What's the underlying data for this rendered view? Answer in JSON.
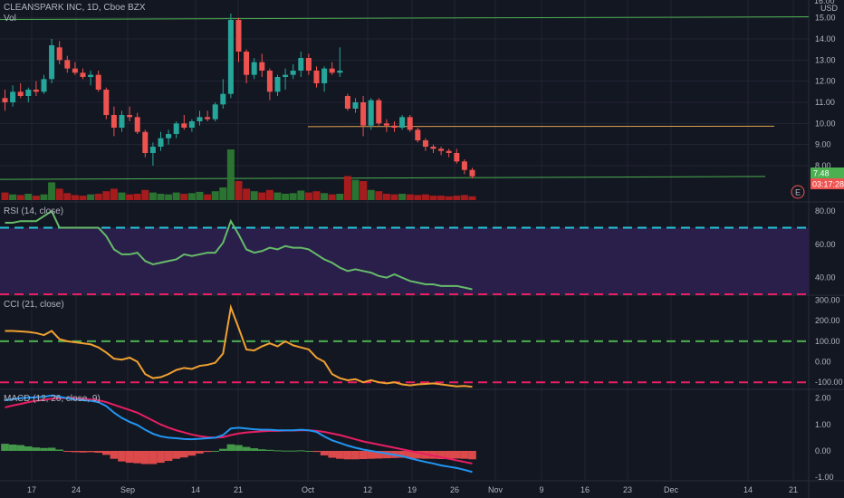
{
  "header": {
    "title": "CLEANSPARK INC, 1D, Cboe BZX",
    "vol_label": "Vol",
    "currency": "USD"
  },
  "colors": {
    "bg": "#131722",
    "grid": "#232632",
    "up": "#26a69a",
    "down": "#ef5350",
    "up_vol": "#2e7d32",
    "down_vol": "#b71c1c",
    "support": "#4caf50",
    "resistance": "#e0a050",
    "rsi_line": "#66bb6a",
    "rsi_fill": "#2a1f4a",
    "cyan_level": "#26c6da",
    "pink_level": "#e91e63",
    "cci_line": "#f0a030",
    "green_level": "#4caf50",
    "macd_line": "#2196f3",
    "signal_line": "#e91e63"
  },
  "price_panel": {
    "y_axis_labels": [
      "15.00",
      "14.00",
      "13.00",
      "12.00",
      "11.00",
      "10.00",
      "9.00",
      "8.00"
    ],
    "ylim": [
      6.5,
      15.5
    ],
    "last_price": "7.48",
    "countdown": "03:17:28",
    "earnings_badge": "E"
  },
  "rsi_panel": {
    "label": "RSI (14, close)",
    "y_axis_labels": [
      "80.00",
      "60.00",
      "40.00"
    ],
    "ylim": [
      30,
      85
    ],
    "upper": 70,
    "lower": 30
  },
  "cci_panel": {
    "label": "CCI (21, close)",
    "y_axis_labels": [
      "300.00",
      "200.00",
      "100.00",
      "0.00",
      "-100.00"
    ],
    "ylim": [
      -130,
      320
    ],
    "upper": 100,
    "lower": -100
  },
  "macd_panel": {
    "label": "MACD (12, 26, close, 9)",
    "y_axis_labels": [
      "2.00",
      "1.00",
      "0.00",
      "-1.00"
    ],
    "ylim": [
      -1.1,
      2.3
    ]
  },
  "x_axis_labels": [
    "17",
    "24",
    "Sep",
    "14",
    "21",
    "Oct",
    "12",
    "19",
    "26",
    "Nov",
    "9",
    "16",
    "23",
    "Dec",
    "14",
    "21"
  ],
  "chart_data": {
    "type": "candlestick",
    "title": "CLEANSPARK INC, 1D, Cboe BZX",
    "candles": [
      [
        11.2,
        11.6,
        10.6,
        11.0
      ],
      [
        11.0,
        11.8,
        10.8,
        11.5
      ],
      [
        11.5,
        11.9,
        11.2,
        11.3
      ],
      [
        11.3,
        11.7,
        11.0,
        11.6
      ],
      [
        11.6,
        12.0,
        11.3,
        11.5
      ],
      [
        11.5,
        12.3,
        11.4,
        12.1
      ],
      [
        12.1,
        14.0,
        11.9,
        13.7
      ],
      [
        13.6,
        13.9,
        12.8,
        13.0
      ],
      [
        13.0,
        13.2,
        12.4,
        12.6
      ],
      [
        12.6,
        12.9,
        12.3,
        12.4
      ],
      [
        12.4,
        12.6,
        12.1,
        12.2
      ],
      [
        12.2,
        12.5,
        11.8,
        12.3
      ],
      [
        12.3,
        12.5,
        11.5,
        11.6
      ],
      [
        11.6,
        11.7,
        10.2,
        10.4
      ],
      [
        10.4,
        10.8,
        9.4,
        9.8
      ],
      [
        9.8,
        10.6,
        9.6,
        10.4
      ],
      [
        10.4,
        10.8,
        10.1,
        10.3
      ],
      [
        10.3,
        10.5,
        9.5,
        9.6
      ],
      [
        9.6,
        9.7,
        8.4,
        8.6
      ],
      [
        8.6,
        9.1,
        8.0,
        8.9
      ],
      [
        8.9,
        9.6,
        8.7,
        9.3
      ],
      [
        9.3,
        9.7,
        9.0,
        9.5
      ],
      [
        9.5,
        10.1,
        9.3,
        10.0
      ],
      [
        10.0,
        10.4,
        9.7,
        9.8
      ],
      [
        9.8,
        10.2,
        9.6,
        10.1
      ],
      [
        10.1,
        10.6,
        9.9,
        10.3
      ],
      [
        10.3,
        10.6,
        10.1,
        10.2
      ],
      [
        10.2,
        11.0,
        10.1,
        10.9
      ],
      [
        10.9,
        12.1,
        10.7,
        11.4
      ],
      [
        11.4,
        15.2,
        11.2,
        14.9
      ],
      [
        14.9,
        15.0,
        12.9,
        13.4
      ],
      [
        13.4,
        13.5,
        11.9,
        12.3
      ],
      [
        12.3,
        13.1,
        12.1,
        12.9
      ],
      [
        12.9,
        13.3,
        12.2,
        12.5
      ],
      [
        12.5,
        12.6,
        11.1,
        11.5
      ],
      [
        11.5,
        12.3,
        11.3,
        12.2
      ],
      [
        12.2,
        12.6,
        11.6,
        12.3
      ],
      [
        12.3,
        12.8,
        12.1,
        12.5
      ],
      [
        12.5,
        13.4,
        12.2,
        13.1
      ],
      [
        13.1,
        13.3,
        12.3,
        12.5
      ],
      [
        12.5,
        12.7,
        11.7,
        11.9
      ],
      [
        11.9,
        12.7,
        11.5,
        12.6
      ],
      [
        12.6,
        12.9,
        12.3,
        12.4
      ],
      [
        12.4,
        13.6,
        12.2,
        12.5
      ],
      [
        11.3,
        11.4,
        10.6,
        10.7
      ],
      [
        10.7,
        11.2,
        10.5,
        11.0
      ],
      [
        11.0,
        11.3,
        9.4,
        9.9
      ],
      [
        9.9,
        11.2,
        9.7,
        11.1
      ],
      [
        11.1,
        11.2,
        9.9,
        10.0
      ],
      [
        10.0,
        10.2,
        9.6,
        9.9
      ],
      [
        9.9,
        10.1,
        9.6,
        9.8
      ],
      [
        9.8,
        10.4,
        9.7,
        10.3
      ],
      [
        10.3,
        10.4,
        9.6,
        9.7
      ],
      [
        9.7,
        9.8,
        9.1,
        9.2
      ],
      [
        9.2,
        9.3,
        8.7,
        8.9
      ],
      [
        8.9,
        9.0,
        8.6,
        8.8
      ],
      [
        8.8,
        8.9,
        8.5,
        8.7
      ],
      [
        8.7,
        8.8,
        8.4,
        8.6
      ],
      [
        8.6,
        8.8,
        8.1,
        8.2
      ],
      [
        8.2,
        8.3,
        7.6,
        7.8
      ],
      [
        7.8,
        7.9,
        7.4,
        7.5
      ]
    ],
    "volume": [
      12,
      9,
      8,
      10,
      7,
      9,
      28,
      18,
      11,
      8,
      7,
      9,
      10,
      14,
      18,
      12,
      9,
      10,
      16,
      12,
      10,
      9,
      12,
      10,
      11,
      13,
      9,
      14,
      20,
      80,
      30,
      18,
      14,
      12,
      16,
      12,
      10,
      11,
      15,
      12,
      14,
      11,
      9,
      10,
      38,
      32,
      30,
      16,
      14,
      10,
      9,
      10,
      9,
      8,
      9,
      7,
      7,
      6,
      7,
      8,
      6
    ],
    "rsi": [
      73,
      73,
      74,
      74,
      74,
      77,
      80,
      70,
      70,
      70,
      70,
      70,
      70,
      65,
      57,
      54,
      54,
      55,
      50,
      48,
      49,
      50,
      51,
      54,
      53,
      54,
      55,
      55,
      61,
      74,
      66,
      57,
      55,
      56,
      58,
      57,
      59,
      58,
      58,
      57,
      54,
      51,
      49,
      46,
      44,
      45,
      44,
      43,
      41,
      40,
      42,
      40,
      38,
      37,
      36,
      36,
      35,
      35,
      35,
      34,
      33
    ],
    "cci": [
      150,
      150,
      148,
      145,
      140,
      130,
      150,
      110,
      100,
      95,
      90,
      85,
      70,
      45,
      15,
      10,
      20,
      0,
      -60,
      -80,
      -75,
      -60,
      -40,
      -30,
      -35,
      -20,
      -15,
      -5,
      40,
      265,
      165,
      60,
      55,
      75,
      90,
      75,
      100,
      80,
      70,
      60,
      20,
      0,
      -60,
      -80,
      -90,
      -85,
      -100,
      -90,
      -100,
      -105,
      -100,
      -110,
      -115,
      -110,
      -108,
      -105,
      -110,
      -115,
      -120,
      -118,
      -122
    ],
    "macd": [
      1.92,
      1.96,
      2.0,
      2.02,
      2.03,
      2.05,
      2.1,
      2.05,
      2.0,
      1.95,
      1.92,
      1.9,
      1.85,
      1.7,
      1.45,
      1.25,
      1.1,
      0.98,
      0.8,
      0.65,
      0.55,
      0.5,
      0.48,
      0.45,
      0.44,
      0.46,
      0.48,
      0.5,
      0.6,
      0.85,
      0.88,
      0.85,
      0.82,
      0.8,
      0.8,
      0.78,
      0.78,
      0.78,
      0.8,
      0.78,
      0.72,
      0.55,
      0.4,
      0.3,
      0.2,
      0.12,
      0.05,
      0.0,
      -0.05,
      -0.1,
      -0.15,
      -0.2,
      -0.28,
      -0.35,
      -0.42,
      -0.48,
      -0.55,
      -0.6,
      -0.65,
      -0.72,
      -0.8
    ],
    "signal": [
      1.65,
      1.72,
      1.78,
      1.85,
      1.9,
      1.94,
      1.98,
      2.0,
      2.01,
      2.0,
      1.98,
      1.95,
      1.92,
      1.85,
      1.75,
      1.65,
      1.55,
      1.45,
      1.3,
      1.15,
      1.0,
      0.88,
      0.78,
      0.7,
      0.62,
      0.56,
      0.52,
      0.5,
      0.52,
      0.6,
      0.66,
      0.7,
      0.72,
      0.74,
      0.76,
      0.76,
      0.77,
      0.77,
      0.78,
      0.78,
      0.76,
      0.72,
      0.66,
      0.6,
      0.52,
      0.44,
      0.36,
      0.3,
      0.24,
      0.18,
      0.12,
      0.06,
      0.0,
      -0.06,
      -0.12,
      -0.18,
      -0.24,
      -0.3,
      -0.36,
      -0.42,
      -0.48
    ],
    "support_level": 7.48,
    "resistance_level": 9.85,
    "top_level": 15.0
  }
}
